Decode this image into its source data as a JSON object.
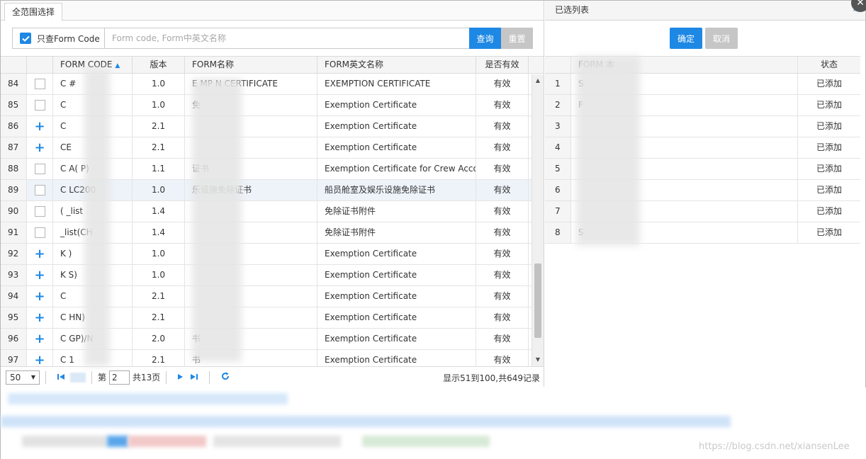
{
  "left_tab": "全范围选择",
  "filter": {
    "checkbox_label": "只查Form Code",
    "checked": true,
    "placeholder": "Form code, Form中英文名称",
    "search_label": "查询",
    "reset_label": "重置"
  },
  "columns": {
    "code": "FORM CODE",
    "version": "版本",
    "name": "FORM名称",
    "en_name": "FORM英文名称",
    "valid": "是否有效"
  },
  "rows": [
    {
      "no": "84",
      "sel": "check",
      "code": "C      #",
      "ver": "1.0",
      "name": "E    MP    N CERTIFICATE",
      "en": "EXEMPTION CERTIFICATE",
      "valid": "有效"
    },
    {
      "no": "85",
      "sel": "check",
      "code": "C",
      "ver": "1.0",
      "name": "免",
      "en": "Exemption Certificate",
      "valid": "有效"
    },
    {
      "no": "86",
      "sel": "plus",
      "code": "C",
      "ver": "2.1",
      "name": "",
      "en": "Exemption Certificate",
      "valid": "有效"
    },
    {
      "no": "87",
      "sel": "plus",
      "code": "CE",
      "ver": "2.1",
      "name": "",
      "en": "Exemption Certificate",
      "valid": "有效"
    },
    {
      "no": "88",
      "sel": "check",
      "code": "C     A(   P)",
      "ver": "1.1",
      "name": "            证书",
      "en": "Exemption Certificate for Crew Accomm",
      "valid": "有效"
    },
    {
      "no": "89",
      "sel": "check",
      "code": "C       LC200",
      "ver": "1.0",
      "name": "          乐设施免除证书",
      "en": "船员舱室及娱乐设施免除证书",
      "valid": "有效"
    },
    {
      "no": "90",
      "sel": "check",
      "code": "(      _list",
      "ver": "1.4",
      "name": "",
      "en": "免除证书附件",
      "valid": "有效"
    },
    {
      "no": "91",
      "sel": "check",
      "code": "      _list(CH",
      "ver": "1.4",
      "name": "",
      "en": "免除证书附件",
      "valid": "有效"
    },
    {
      "no": "92",
      "sel": "plus",
      "code": "     K    )",
      "ver": "1.0",
      "name": "",
      "en": "Exemption Certificate",
      "valid": "有效"
    },
    {
      "no": "93",
      "sel": "plus",
      "code": "     K   S)",
      "ver": "1.0",
      "name": "",
      "en": "Exemption Certificate",
      "valid": "有效"
    },
    {
      "no": "94",
      "sel": "plus",
      "code": "C",
      "ver": "2.1",
      "name": "",
      "en": "Exemption Certificate",
      "valid": "有效"
    },
    {
      "no": "95",
      "sel": "plus",
      "code": "C    HN)",
      "ver": "2.1",
      "name": "",
      "en": "Exemption Certificate",
      "valid": "有效"
    },
    {
      "no": "96",
      "sel": "plus",
      "code": "C    GP)/N",
      "ver": "2.0",
      "name": "书",
      "en": "Exemption Certificate",
      "valid": "有效"
    },
    {
      "no": "97",
      "sel": "plus",
      "code": "C     1",
      "ver": "2.1",
      "name": "书",
      "en": "Exemption Certificate",
      "valid": "有效"
    }
  ],
  "pager": {
    "page_size": "50",
    "page_prefix": "第",
    "page_value": "2",
    "total_pages": "共13页",
    "info": "显示51到100,共649记录"
  },
  "right": {
    "title": "已选列表",
    "ok_label": "确定",
    "cancel_label": "取消",
    "col_code": "FORM    本",
    "col_status": "状态",
    "rows": [
      {
        "no": "1",
        "code": "S",
        "status": "已添加"
      },
      {
        "no": "2",
        "code": "F",
        "status": "已添加"
      },
      {
        "no": "3",
        "code": "",
        "status": "已添加"
      },
      {
        "no": "4",
        "code": "",
        "status": "已添加"
      },
      {
        "no": "5",
        "code": "",
        "status": "已添加"
      },
      {
        "no": "6",
        "code": "",
        "status": "已添加"
      },
      {
        "no": "7",
        "code": "",
        "status": "已添加"
      },
      {
        "no": "8",
        "code": "S",
        "status": "已添加"
      }
    ]
  },
  "watermark": "https://blog.csdn.net/xiansenLee",
  "colors": {
    "accent": "#1e88e5",
    "disabled": "#c6c6c6"
  }
}
